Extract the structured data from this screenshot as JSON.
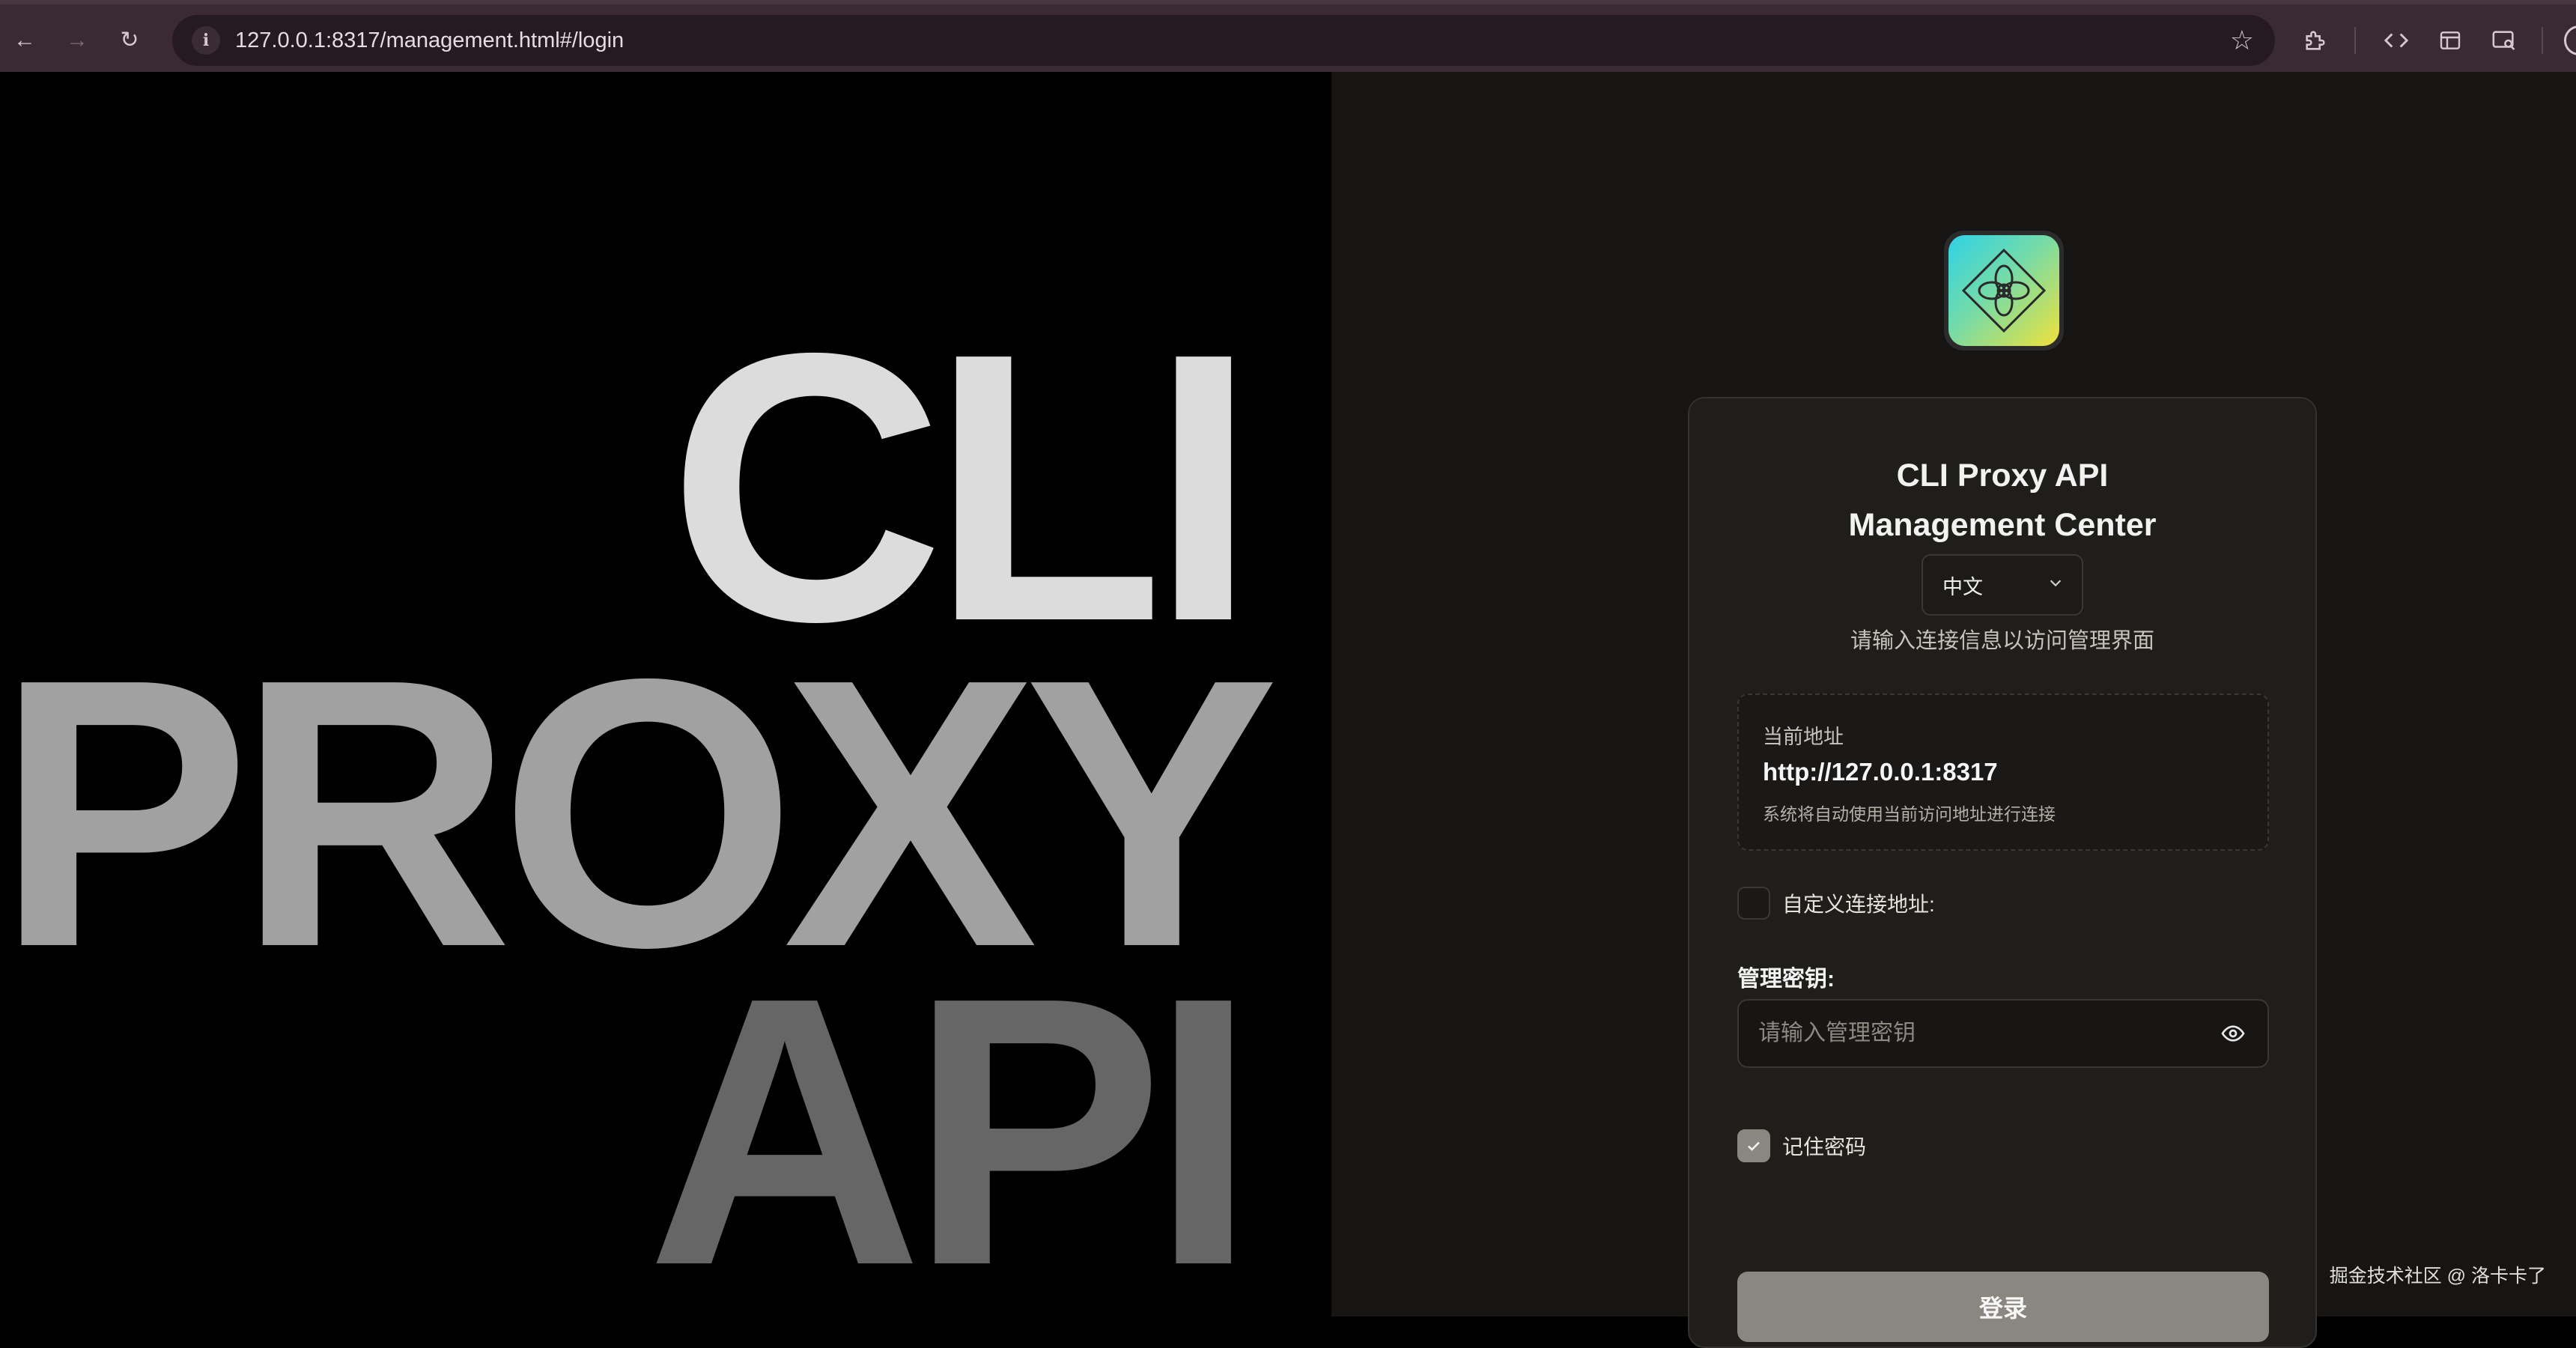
{
  "browser": {
    "url": "127.0.0.1:8317/management.html#/login",
    "back_icon": "←",
    "forward_icon": "→",
    "reload_icon": "↻",
    "info_icon": "i",
    "star_icon": "☆"
  },
  "hero": {
    "line1": "CLI",
    "line2": "PROXY",
    "line3": "API",
    "colors": [
      "#dcdcdc",
      "#a1a1a1",
      "#666666"
    ]
  },
  "login": {
    "title": "CLI Proxy API Management Center",
    "language": "中文",
    "subtitle": "请输入连接信息以访问管理界面",
    "current_address_label": "当前地址",
    "current_address": "http://127.0.0.1:8317",
    "address_hint": "系统将自动使用当前访问地址进行连接",
    "custom_address_label": "自定义连接地址:",
    "custom_address_checked": false,
    "key_label": "管理密钥:",
    "key_placeholder": "请输入管理密钥",
    "key_value": "",
    "remember_label": "记住密码",
    "remember_checked": true,
    "login_button": "登录",
    "accent_color": "#8a8680"
  },
  "watermark": "掘金技术社区 @ 洛卡卡了"
}
